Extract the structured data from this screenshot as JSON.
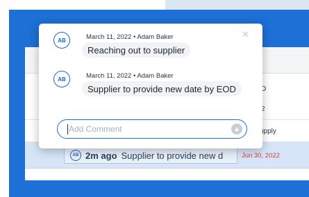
{
  "popover": {
    "close_icon": "close-icon",
    "comments": [
      {
        "initials": "AB",
        "date": "March 11, 2022",
        "author": "Adam Baker",
        "text": "Reaching out to supplier"
      },
      {
        "initials": "AB",
        "date": "March 11, 2022",
        "author": "Adam Baker",
        "text": "Supplier to provide new date by EOD"
      }
    ],
    "input": {
      "placeholder": "Add Comment",
      "value": "",
      "send_icon": "send-arrow-icon"
    }
  },
  "table": {
    "row_fragments": [
      "D",
      "2",
      "upply"
    ],
    "highlighted_row": {
      "initials": "AB",
      "time": "2m ago",
      "text": "Supplier to provide new d",
      "due_date": "Jun 30, 2022"
    }
  },
  "colors": {
    "brand_blue": "#1e6fd6",
    "due_red": "#d93b3b",
    "highlight_row": "#d6e6f8"
  }
}
